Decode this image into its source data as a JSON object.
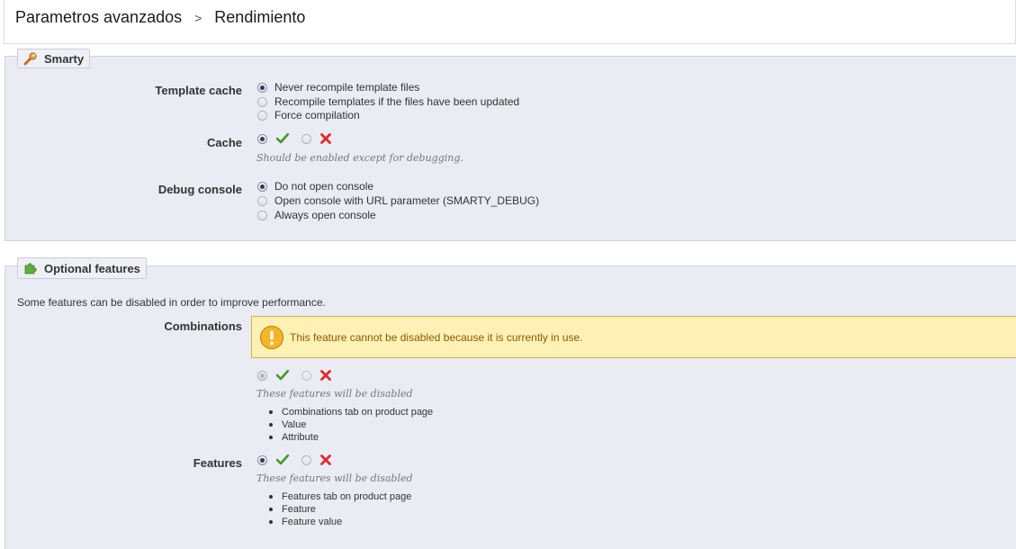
{
  "breadcrumb": {
    "parent": "Parametros avanzados",
    "separator": ">",
    "current": "Rendimiento"
  },
  "smarty": {
    "legend": "Smarty",
    "template_cache": {
      "label": "Template cache",
      "options": [
        "Never recompile template files",
        "Recompile templates if the files have been updated",
        "Force compilation"
      ],
      "selected": 0
    },
    "cache": {
      "label": "Cache",
      "value": "yes",
      "hint": "Should be enabled except for debugging."
    },
    "debug_console": {
      "label": "Debug console",
      "options": [
        "Do not open console",
        "Open console with URL parameter (SMARTY_DEBUG)",
        "Always open console"
      ],
      "selected": 0
    }
  },
  "optional": {
    "legend": "Optional features",
    "intro": "Some features can be disabled in order to improve performance.",
    "combinations": {
      "label": "Combinations",
      "warning": "This feature cannot be disabled because it is currently in use.",
      "value": "yes",
      "disabled": true,
      "hint": "These features will be disabled",
      "items": [
        "Combinations tab on product page",
        "Value",
        "Attribute"
      ]
    },
    "features": {
      "label": "Features",
      "value": "yes",
      "hint": "These features will be disabled",
      "items": [
        "Features tab on product page",
        "Feature",
        "Feature value"
      ]
    }
  },
  "colors": {
    "panel_bg": "#eaecf3",
    "warning_bg": "#fff1b5",
    "warning_text": "#8a5a00",
    "yes_green": "#3f9a2a",
    "no_red": "#e0282e"
  }
}
